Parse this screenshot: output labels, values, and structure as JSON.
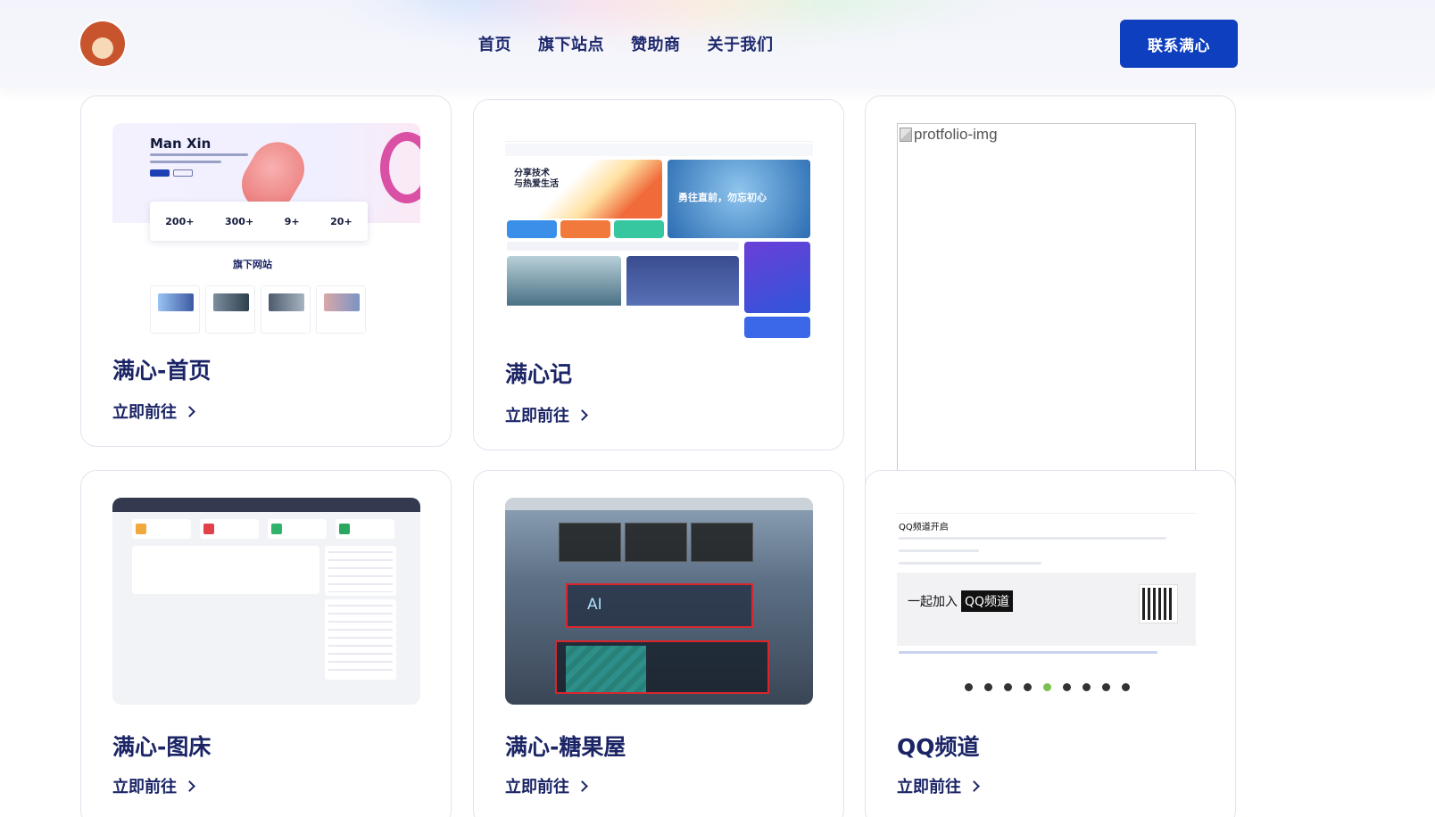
{
  "header": {
    "nav": [
      "首页",
      "旗下站点",
      "赞助商",
      "关于我们"
    ],
    "contact_label": "联系满心",
    "logo_icon": "mushroom-avatar-logo"
  },
  "cards": [
    {
      "title": "满心-首页",
      "link": "立即前往",
      "thumb": {
        "brand": "Man Xin",
        "stats": [
          "200+",
          "300+",
          "9+",
          "20+"
        ],
        "section": "旗下网站"
      }
    },
    {
      "title": "满心记",
      "link": "立即前往",
      "thumb": {
        "tile_a": "分享技术\n与热爱生活",
        "tile_b": "勇往直前，勿忘初心"
      }
    },
    {
      "title": "",
      "link": "",
      "thumb": {
        "broken_alt": "protfolio-img"
      }
    },
    {
      "title": "满心-图床",
      "link": "立即前往",
      "thumb": {}
    },
    {
      "title": "满心-糖果屋",
      "link": "立即前往",
      "thumb": {
        "ai_label": "AI"
      }
    },
    {
      "title": "QQ频道",
      "link": "立即前往",
      "thumb": {
        "heading": "QQ频道开启",
        "join_prefix": "一起加入",
        "join_badge": "QQ频道"
      }
    }
  ],
  "colors": {
    "accent": "#0d3fbe",
    "title_text": "#1b2566",
    "card_border": "#e1e4ee"
  }
}
